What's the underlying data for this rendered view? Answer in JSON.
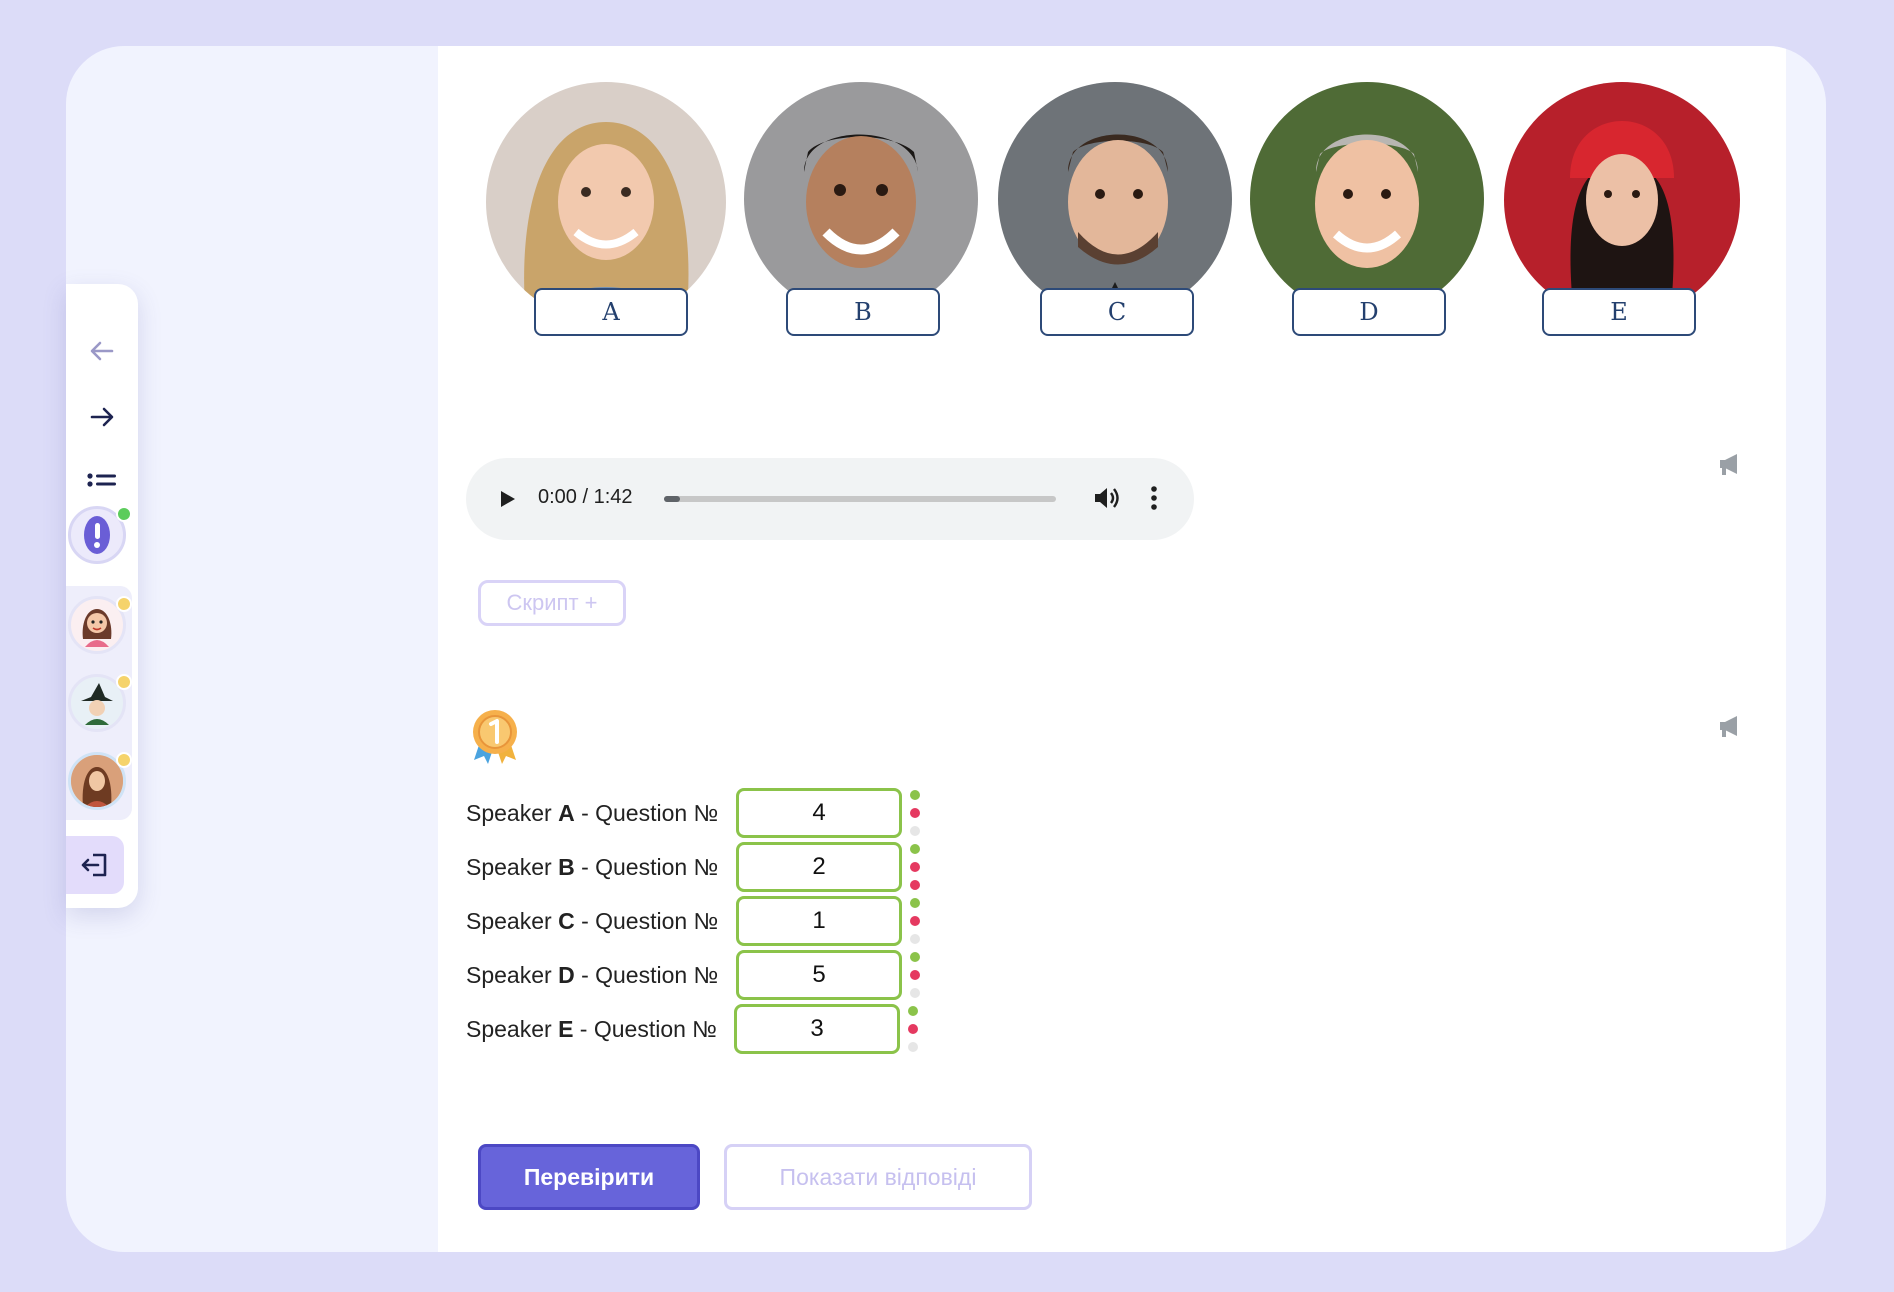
{
  "speakers": [
    {
      "letter": "A",
      "photo": "woman-blonde-denim-jacket"
    },
    {
      "letter": "B",
      "photo": "man-smiling-short-black-hair"
    },
    {
      "letter": "C",
      "photo": "man-beard-hoodie"
    },
    {
      "letter": "D",
      "photo": "man-grey-hair-smiling"
    },
    {
      "letter": "E",
      "photo": "woman-red-beanie"
    }
  ],
  "audio": {
    "time": "0:00 / 1:42",
    "progress": 0.0
  },
  "script_button": "Скрипт +",
  "questions": [
    {
      "prefix": "Speaker ",
      "speaker": "A",
      "suffix": " - Question №",
      "value": "4"
    },
    {
      "prefix": "Speaker ",
      "speaker": "B",
      "suffix": " - Question №",
      "value": "2"
    },
    {
      "prefix": "Speaker ",
      "speaker": "C",
      "suffix": " - Question №",
      "value": "1"
    },
    {
      "prefix": "Speaker ",
      "speaker": "D",
      "suffix": " - Question №",
      "value": "5"
    },
    {
      "prefix": "Speaker ",
      "speaker": "E",
      "suffix": " - Question №",
      "value": "3"
    }
  ],
  "buttons": {
    "check": "Перевірити",
    "show_answers": "Показати відповіді"
  },
  "colors": {
    "accent": "#6764da",
    "correct_border": "#8bc34a",
    "dot_green": "#8bc34a",
    "dot_red": "#e53960",
    "dot_grey": "#e6e6e6"
  },
  "icons": {
    "nav_back": "arrow-left-icon",
    "nav_forward": "arrow-right-icon",
    "nav_list": "list-icon",
    "medal": "medal-icon",
    "announce": "megaphone-icon",
    "exit": "exit-icon"
  }
}
